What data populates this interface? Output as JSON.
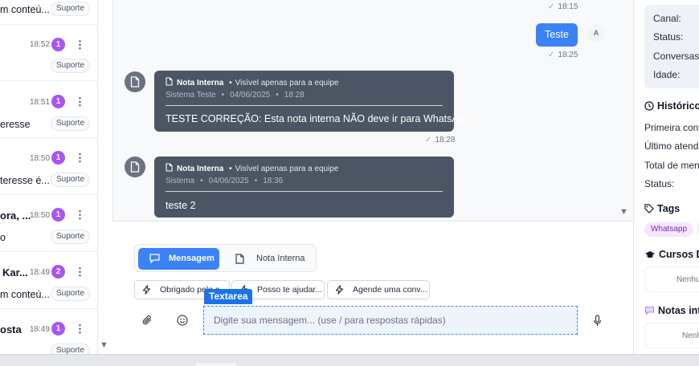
{
  "conversations": [
    {
      "name": "m conteú...",
      "time": "",
      "unread": "",
      "tag": "Suporte"
    },
    {
      "name": "",
      "time": "18:52",
      "unread": "1",
      "tag": "Suporte"
    },
    {
      "name": "eresse",
      "time": "18:51",
      "unread": "1",
      "tag": "Suporte"
    },
    {
      "name": "teresse é...",
      "time": "18:50",
      "unread": "1",
      "tag": "Suporte"
    },
    {
      "name": "ora, ...",
      "preview": "o",
      "time": "18:50",
      "unread": "1",
      "tag": "Suporte"
    },
    {
      "name": "Kar...",
      "preview": "m conteú...",
      "time": "18:49",
      "unread": "2",
      "tag": "Suporte"
    },
    {
      "name": "osta",
      "time": "18:49",
      "unread": "1",
      "tag": "Suporte"
    }
  ],
  "chat": {
    "first_tick": "18:15",
    "outgoing": {
      "text": "Teste",
      "time": "18:25",
      "avatar": "A"
    },
    "notes": [
      {
        "title": "Nota Interna",
        "visibility": "Visível apenas para a equipe",
        "author": "Sistema Teste",
        "date": "04/06/2025",
        "time": "18:28",
        "text": "TESTE CORREÇÃO: Esta nota interna NÃO deve ir para WhatsApp",
        "tick_time": "18:28"
      },
      {
        "title": "Nota Interna",
        "visibility": "Visível apenas para a equipe",
        "author": "Sistema",
        "date": "04/06/2025",
        "time": "18:36",
        "text": "teste 2"
      }
    ]
  },
  "composer": {
    "mode_message": "Mensagem",
    "mode_note": "Nota Interna",
    "quick_replies": [
      "Obrigado pelo c...",
      "Posso te ajudar...",
      "Agende uma conv..."
    ],
    "placeholder": "Digite sua mensagem... (use / para respostas rápidas)",
    "overlay_label": "Textarea"
  },
  "sidebar": {
    "info_labels": [
      "Canal:",
      "Status:",
      "Conversas:",
      "Idade:"
    ],
    "history_title": "Histórico",
    "history_items": [
      "Primeira conv",
      "Último atend",
      "Total de mens",
      "Status:"
    ],
    "tags_title": "Tags",
    "tags": [
      "Whatsapp"
    ],
    "courses_title": "Cursos De",
    "courses_empty": "Nenhu",
    "notes_title": "Notas int",
    "notes_empty": "Nenh"
  },
  "colors": {
    "primary": "#3b82f6",
    "badge": "#a855f7",
    "note_bg": "#4b5563",
    "overlay": "#1a73e8"
  }
}
